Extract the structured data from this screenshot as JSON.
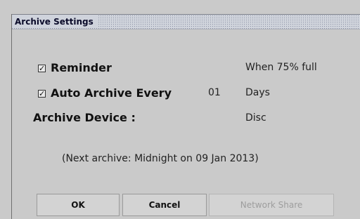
{
  "dialog": {
    "title": "Archive Settings"
  },
  "settings": {
    "reminder_checked": "✓",
    "reminder_label": "Reminder",
    "reminder_value": "When 75% full",
    "auto_checked": "✓",
    "auto_label": "Auto Archive Every",
    "auto_interval": "01",
    "auto_unit": "Days",
    "device_label": "Archive Device :",
    "device_value": "Disc",
    "next_archive_note": "(Next archive: Midnight on 09 Jan 2013)"
  },
  "buttons": {
    "ok": "OK",
    "cancel": "Cancel",
    "network_share": "Network Share"
  }
}
